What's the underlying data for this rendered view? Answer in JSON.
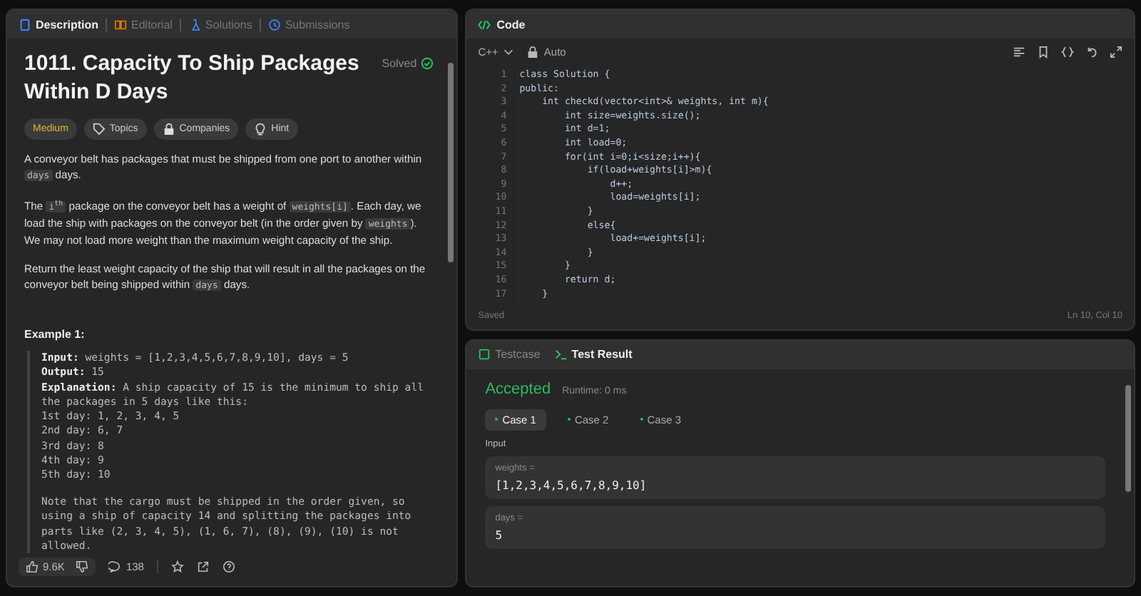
{
  "description_panel": {
    "tabs": [
      {
        "label": "Description",
        "selected": true
      },
      {
        "label": "Editorial",
        "selected": false
      },
      {
        "label": "Solutions",
        "selected": false
      },
      {
        "label": "Submissions",
        "selected": false
      }
    ],
    "title": "1011. Capacity To Ship Packages Within D Days",
    "status": "Solved",
    "tags": [
      {
        "label": "Medium",
        "kind": "difficulty"
      },
      {
        "label": "Topics",
        "kind": "topics"
      },
      {
        "label": "Companies",
        "kind": "companies"
      },
      {
        "label": "Hint",
        "kind": "hint"
      }
    ],
    "paragraphs": [
      [
        {
          "kind": "text",
          "text": "A conveyor belt has packages that must be shipped from one port to another within "
        },
        {
          "kind": "code",
          "text": "days"
        },
        {
          "kind": "text",
          "text": " days."
        }
      ],
      [
        {
          "kind": "text",
          "text": "The "
        },
        {
          "kind": "code",
          "text": "i$^{th}$"
        },
        {
          "kind": "text",
          "text": " package on the conveyor belt has a weight of "
        },
        {
          "kind": "code",
          "text": "weights[i]"
        },
        {
          "kind": "text",
          "text": ". Each day, we load the ship with packages on the conveyor belt (in the order given by "
        },
        {
          "kind": "code",
          "text": "weights"
        },
        {
          "kind": "text",
          "text": "). We may not load more weight than the maximum weight capacity of the ship."
        }
      ],
      [
        {
          "kind": "text",
          "text": "Return the least weight capacity of the ship that will result in all the packages on the conveyor belt being shipped within "
        },
        {
          "kind": "code",
          "text": "days"
        },
        {
          "kind": "text",
          "text": " days."
        }
      ]
    ],
    "example": {
      "title": "Example 1:",
      "blocks": [
        [
          "**Input:** weights = [1,2,3,4,5,6,7,8,9,10], days = 5",
          "**Output:** 15",
          "**Explanation:** A ship capacity of 15 is the minimum to ship all",
          "the packages in 5 days like this:",
          "1st day: 1, 2, 3, 4, 5",
          "2nd day: 6, 7",
          "3rd day: 8",
          "4th day: 9",
          "5th day: 10"
        ],
        [
          "Note that the cargo must be shipped in the order given, so",
          "using a ship of capacity 14 and splitting the packages into",
          "parts like (2, 3, 4, 5), (1, 6, 7), (8), (9), (10) is not",
          "allowed."
        ]
      ]
    },
    "footer": {
      "likes": "9.6K",
      "comments": "138"
    }
  },
  "code_panel": {
    "title": "Code",
    "language": "C++",
    "mode": "Auto",
    "lines": [
      "class Solution {",
      "public:",
      "    int checkd(vector<int>& weights, int m){",
      "        int size=weights.size();",
      "        int d=1;",
      "        int load=0;",
      "        for(int i=0;i<size;i++){",
      "            if(load+weights[i]>m){",
      "                d++;",
      "                load=weights[i];",
      "            }",
      "            else{",
      "                load+=weights[i];",
      "            }",
      "        }",
      "        return d;",
      "    }"
    ],
    "line_numbers": [
      "1",
      "2",
      "3",
      "4",
      "5",
      "6",
      "7",
      "8",
      "9",
      "10",
      "11",
      "12",
      "13",
      "14",
      "15",
      "16",
      "17"
    ],
    "saved": "Saved",
    "cursor": "Ln 10, Col 10"
  },
  "result_panel": {
    "tabs": [
      {
        "label": "Testcase",
        "selected": false
      },
      {
        "label": "Test Result",
        "selected": true
      }
    ],
    "verdict": "Accepted",
    "runtime": "Runtime: 0 ms",
    "cases": [
      {
        "label": "Case 1",
        "selected": true
      },
      {
        "label": "Case 2",
        "selected": false
      },
      {
        "label": "Case 3",
        "selected": false
      }
    ],
    "input_label": "Input",
    "inputs": [
      {
        "name": "weights =",
        "value": "[1,2,3,4,5,6,7,8,9,10]"
      },
      {
        "name": "days =",
        "value": "5"
      }
    ]
  }
}
